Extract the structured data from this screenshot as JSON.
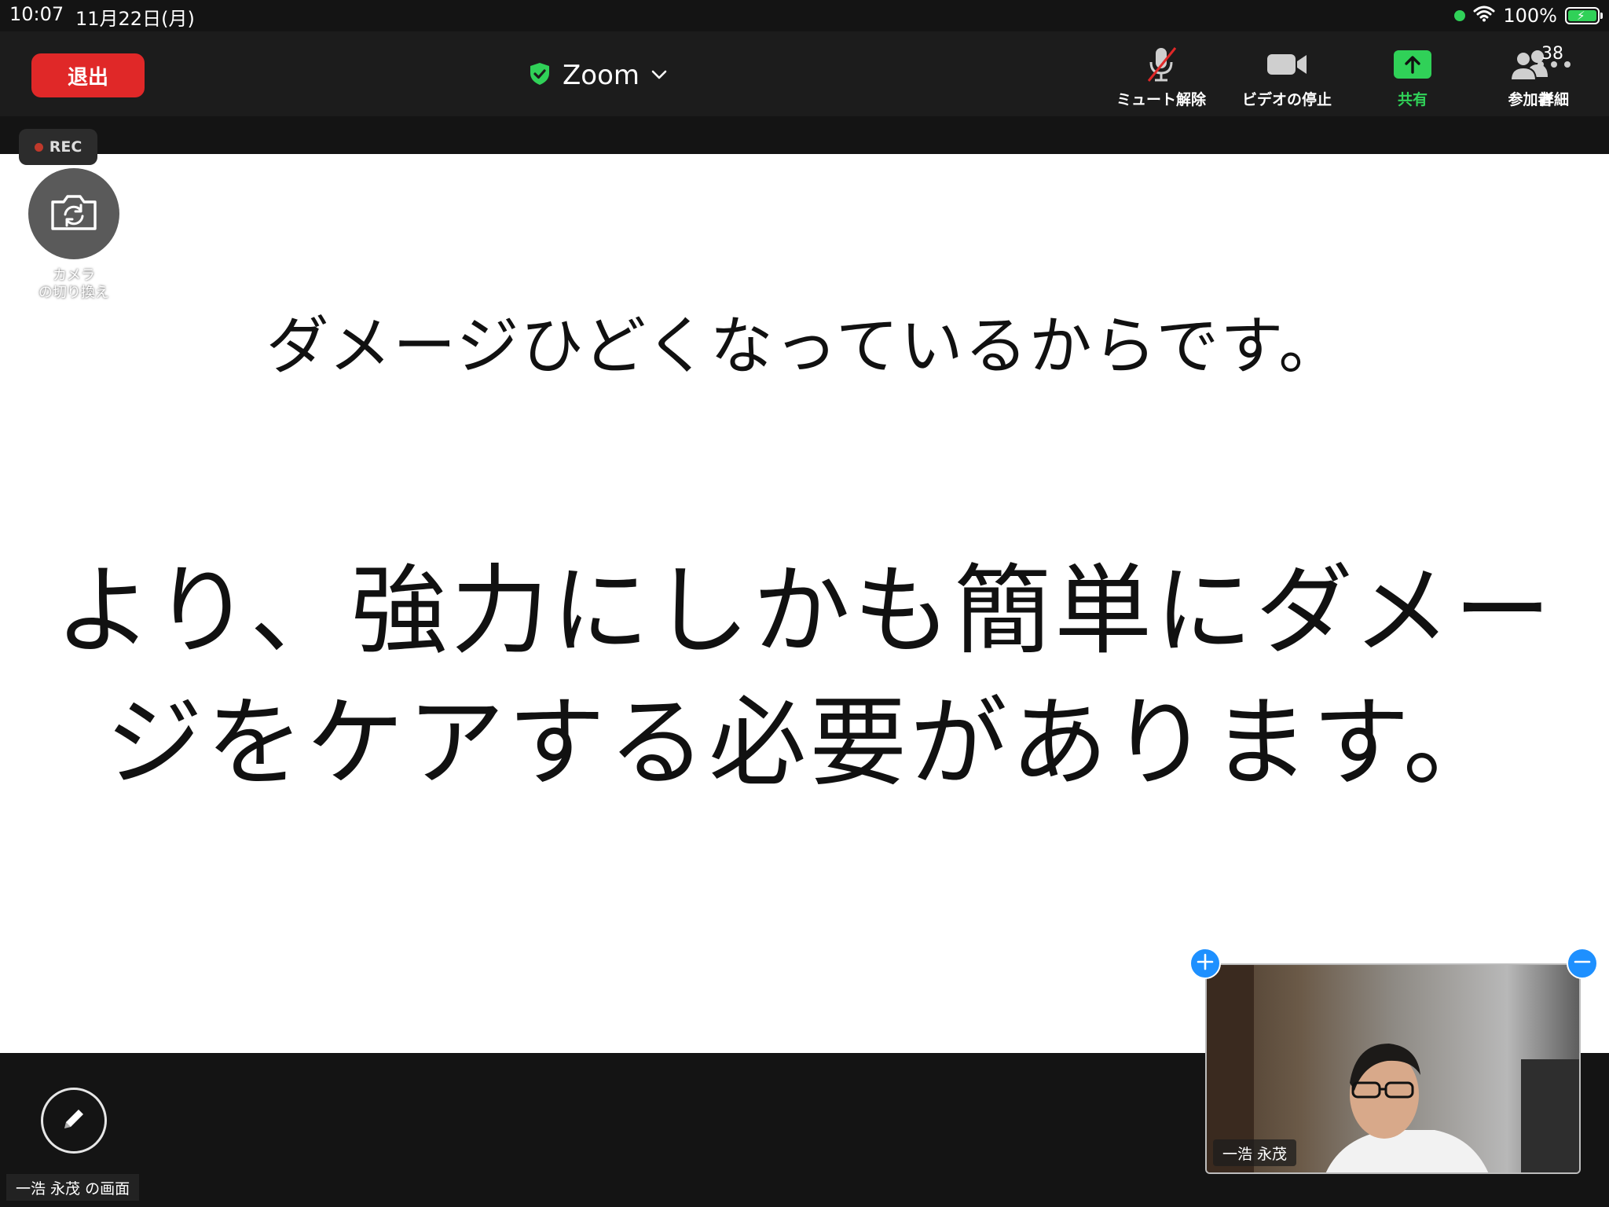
{
  "status_bar": {
    "time": "10:07",
    "date": "11月22日(月)",
    "battery_percent_label": "100%",
    "battery_level": 1.0
  },
  "meeting": {
    "leave_label": "退出",
    "title": "Zoom",
    "controls": {
      "unmute_label": "ミュート解除",
      "stop_video_label": "ビデオの停止",
      "share_label": "共有",
      "participants_label": "参加者",
      "participants_count": "38",
      "more_label": "詳細"
    },
    "rec_label": "REC"
  },
  "camera_switch": {
    "label_line1": "カメラ",
    "label_line2": "の切り換え"
  },
  "slide": {
    "line1": "ダメージひどくなっているからです。",
    "line2": "より、強力にしかも簡単にダメー",
    "line3": "ジをケアする必要があります。"
  },
  "bottom": {
    "screen_owner_label": "一浩 永茂 の画面"
  },
  "video_tile": {
    "participant_name": "一浩 永茂"
  },
  "colors": {
    "leave": "#e02828",
    "share_green": "#30d158",
    "shield_green": "#30d158",
    "accent_blue": "#1e90ff"
  }
}
